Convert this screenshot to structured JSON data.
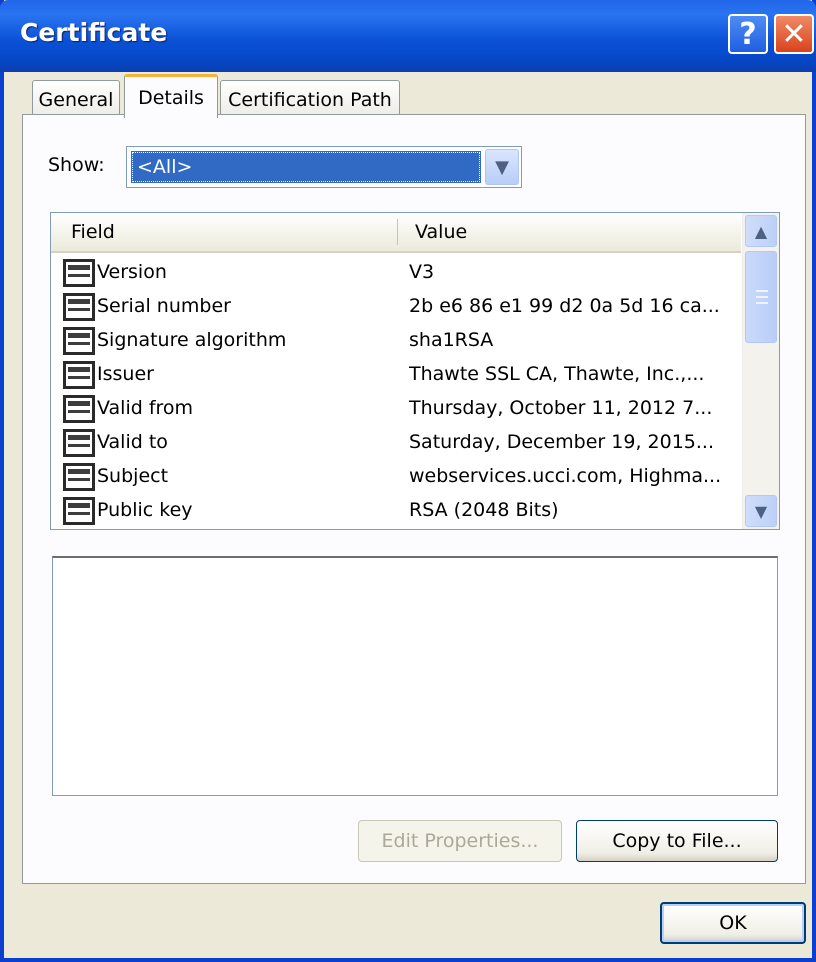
{
  "window": {
    "title": "Certificate",
    "help_symbol": "?",
    "close_symbol": "✕"
  },
  "tabs": [
    {
      "label": "General",
      "active": false
    },
    {
      "label": "Details",
      "active": true
    },
    {
      "label": "Certification Path",
      "active": false
    }
  ],
  "show": {
    "label": "Show:",
    "selected": "<All>",
    "arrow_icon": "chevron-down-icon"
  },
  "fields_table": {
    "columns": [
      "Field",
      "Value"
    ],
    "rows": [
      {
        "field": "Version",
        "value": "V3"
      },
      {
        "field": "Serial number",
        "value": "2b e6 86 e1 99 d2 0a 5d 16 ca..."
      },
      {
        "field": "Signature algorithm",
        "value": "sha1RSA"
      },
      {
        "field": "Issuer",
        "value": "Thawte SSL CA, Thawte, Inc.,..."
      },
      {
        "field": "Valid from",
        "value": "Thursday, October 11, 2012 7..."
      },
      {
        "field": "Valid to",
        "value": "Saturday, December 19, 2015..."
      },
      {
        "field": "Subject",
        "value": "webservices.ucci.com, Highma..."
      },
      {
        "field": "Public key",
        "value": "RSA (2048 Bits)"
      }
    ]
  },
  "buttons": {
    "edit_properties": "Edit Properties...",
    "copy_to_file": "Copy to File...",
    "ok": "OK"
  },
  "colors": {
    "title_bar": "#0b52d8",
    "selection": "#316ac5",
    "active_tab_accent": "#f7b23b",
    "dialog_background": "#ece9d8"
  }
}
